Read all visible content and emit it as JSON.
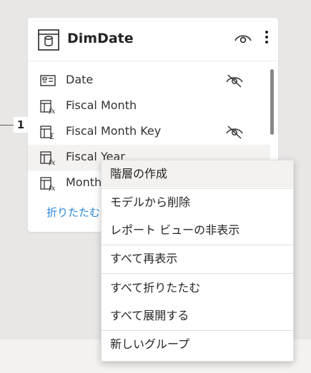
{
  "relationship": {
    "cardinality": "1"
  },
  "table": {
    "name": "DimDate",
    "fields": [
      {
        "name": "Date",
        "icon": "calendar-field-icon",
        "hidden": true
      },
      {
        "name": "Fiscal Month",
        "icon": "calculated-column-icon",
        "hidden": false
      },
      {
        "name": "Fiscal Month Key",
        "icon": "summarized-column-icon",
        "hidden": true
      },
      {
        "name": "Fiscal Year",
        "icon": "calculated-column-icon",
        "hidden": false,
        "selected": true
      },
      {
        "name": "Month",
        "icon": "calculated-column-icon",
        "hidden": false
      }
    ],
    "collapse_label": "折りたたむ"
  },
  "context_menu": {
    "items": [
      "階層の作成",
      "モデルから削除",
      "レポート ビューの非表示",
      "すべて再表示",
      "すべて折りたたむ",
      "すべて展開する",
      "新しいグループ"
    ]
  },
  "colors": {
    "link": "#2b88d8",
    "hover": "#f3f2f1",
    "canvas": "#e8e7e6"
  }
}
